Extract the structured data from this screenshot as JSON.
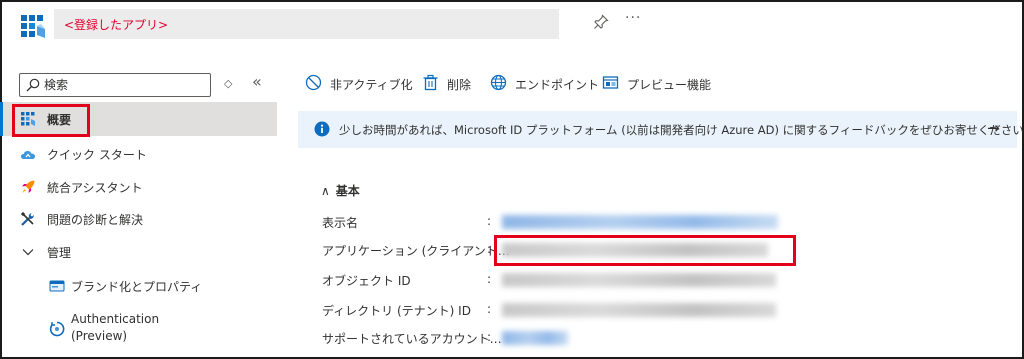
{
  "header": {
    "title": "<登録したアプリ>",
    "more": "···"
  },
  "sidebar": {
    "search_placeholder": "検索",
    "updown": "◇",
    "collapse": "«",
    "items": [
      {
        "label": "概要",
        "icon": "overview-grid-icon",
        "selected": true
      },
      {
        "label": "クイック スタート",
        "icon": "quickstart-cloud-icon"
      },
      {
        "label": "統合アシスタント",
        "icon": "rocket-icon"
      },
      {
        "label": "問題の診断と解決",
        "icon": "wrench-icon"
      },
      {
        "label": "管理",
        "icon": "chevron-down-icon",
        "expanded": true
      },
      {
        "label": "ブランド化とプロパティ",
        "icon": "branding-card-icon"
      },
      {
        "label": "Authentication",
        "label2": "(Preview)",
        "icon": "authentication-icon"
      }
    ]
  },
  "toolbar": {
    "items": [
      {
        "label": "非アクティブ化",
        "icon": "deactivate-icon"
      },
      {
        "label": "削除",
        "icon": "trash-icon"
      },
      {
        "label": "エンドポイント",
        "icon": "globe-icon"
      },
      {
        "label": "プレビュー機能",
        "icon": "preview-features-icon"
      }
    ]
  },
  "banner": {
    "text": "少しお時間があれば、Microsoft ID プラットフォーム (以前は開発者向け Azure AD) に関するフィードバックをぜひお寄せください。",
    "arrow": "→"
  },
  "essentials": {
    "heading": "基本",
    "chevron": "∧",
    "colon": ":",
    "properties": [
      {
        "label": "表示名"
      },
      {
        "label": "アプリケーション (クライアント…"
      },
      {
        "label": "オブジェクト ID"
      },
      {
        "label": "ディレクトリ (テナント) ID"
      },
      {
        "label": "サポートされているアカウント…"
      }
    ]
  },
  "colors": {
    "accent": "#0078d4",
    "highlight_box": "#e3001b",
    "title_text": "#e3002b",
    "banner_bg": "#eaf3fb",
    "selected_bg": "#e1dfdd"
  }
}
